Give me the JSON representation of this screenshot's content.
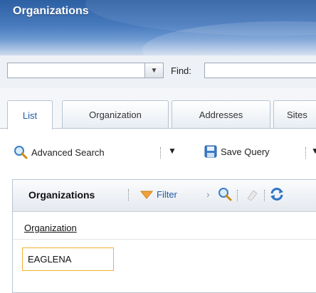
{
  "window": {
    "title": "Organizations"
  },
  "findbar": {
    "combo_value": "",
    "find_label": "Find:",
    "find_value": ""
  },
  "tabs": [
    {
      "label": "List",
      "active": true
    },
    {
      "label": "Organization",
      "active": false
    },
    {
      "label": "Addresses",
      "active": false
    },
    {
      "label": "Sites",
      "active": false
    }
  ],
  "toolbar": {
    "advanced_search_label": "Advanced Search",
    "save_query_label": "Save Query"
  },
  "list_panel": {
    "title": "Organizations",
    "filter_label": "Filter",
    "column_header": "Organization",
    "rows": [
      {
        "organization": "EAGLENA"
      }
    ]
  },
  "colors": {
    "accent": "#1f5aa5",
    "title_bg": "#2d5fa3",
    "filter": "#f2a23a",
    "highlight_border": "#f2b233"
  }
}
